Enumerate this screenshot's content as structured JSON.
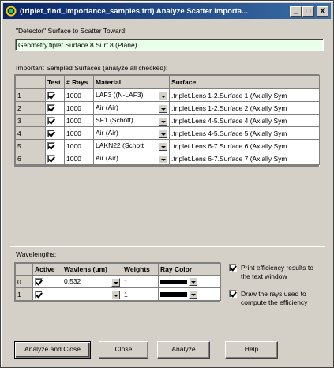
{
  "window": {
    "title": "(triplet_find_importance_samples.frd) Analyze Scatter Importa...",
    "minimize": "_",
    "maximize": "□",
    "close": "X"
  },
  "detector": {
    "label": "\"Detector\" Surface to Scatter Toward:",
    "value": "Geometry.tiplet.Surface 8.Surf 8   (Plane)"
  },
  "surfaces": {
    "label": "Important Sampled Surfaces (analyze all checked):",
    "headers": [
      "Test",
      "# Rays",
      "Material",
      "Surface"
    ],
    "rows": [
      {
        "num": "1",
        "rays": "1000",
        "material": "LAF3   ((N-LAF3)",
        "surface": ".triplet.Lens 1-2.Surface 1    (Axially Sym"
      },
      {
        "num": "2",
        "rays": "1000",
        "material": "Air   (Air)",
        "surface": ".triplet.Lens 1-2.Surface 2    (Axially Sym"
      },
      {
        "num": "3",
        "rays": "1000",
        "material": "SF1   (Schott)",
        "surface": ".triplet.Lens 4-5.Surface 4    (Axially Sym"
      },
      {
        "num": "4",
        "rays": "1000",
        "material": "Air   (Air)",
        "surface": ".triplet.Lens 4-5.Surface 5    (Axially Sym"
      },
      {
        "num": "5",
        "rays": "1000",
        "material": "LAKN22   (Schott",
        "surface": ".triplet.Lens 6-7.Surface 6    (Axially Sym"
      },
      {
        "num": "6",
        "rays": "1000",
        "material": "Air   (Air)",
        "surface": ".triplet.Lens 6-7.Surface 7    (Axially Sym"
      }
    ]
  },
  "wavelengths": {
    "label": "Wavelengths:",
    "headers": [
      "Active",
      "Wavlens (um)",
      "Weights",
      "Ray Color"
    ],
    "rows": [
      {
        "num": "0",
        "wavelen": "0.532",
        "weight": "1"
      },
      {
        "num": "1",
        "wavelen": "",
        "weight": "1"
      }
    ],
    "ray_color": "#000000"
  },
  "options": {
    "print_efficiency": "Print efficiency results to the text window",
    "draw_rays": "Draw the rays used to compute the efficiency"
  },
  "buttons": {
    "analyze_close": "Analyze and Close",
    "close": "Close",
    "analyze": "Analyze",
    "help": "Help"
  },
  "colors": {
    "titlebar": "#0a246a",
    "detector_field_bg": "#e8ffe8",
    "face": "#d4d0c8"
  }
}
